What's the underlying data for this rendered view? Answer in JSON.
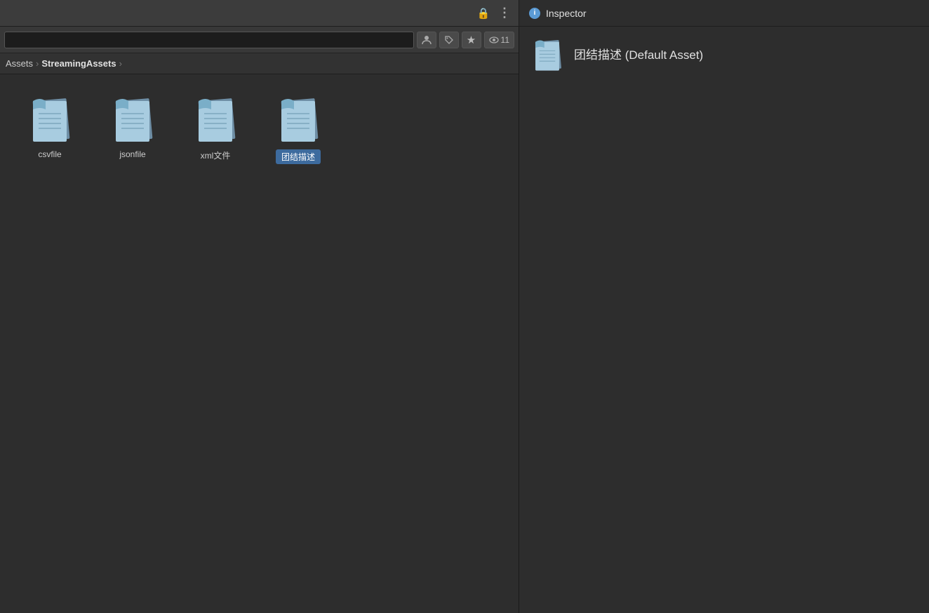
{
  "topbar": {
    "lock_icon": "🔒",
    "more_icon": "⋮",
    "inspector_label": "Inspector",
    "inspector_info_icon": "i"
  },
  "toolbar": {
    "search_placeholder": "",
    "filter_icon": "◉",
    "tag_icon": "🏷",
    "star_icon": "★",
    "eye_icon": "👁",
    "eye_count": "11"
  },
  "breadcrumb": {
    "root": "Assets",
    "separator": "›",
    "current": "StreamingAssets",
    "arrow": "›"
  },
  "files": [
    {
      "label": "csvfile",
      "selected": false
    },
    {
      "label": "jsonfile",
      "selected": false
    },
    {
      "label": "xml文件",
      "selected": false
    },
    {
      "label": "团结描述",
      "selected": true
    }
  ],
  "inspector": {
    "asset_name": "团结描述 (Default Asset)"
  }
}
